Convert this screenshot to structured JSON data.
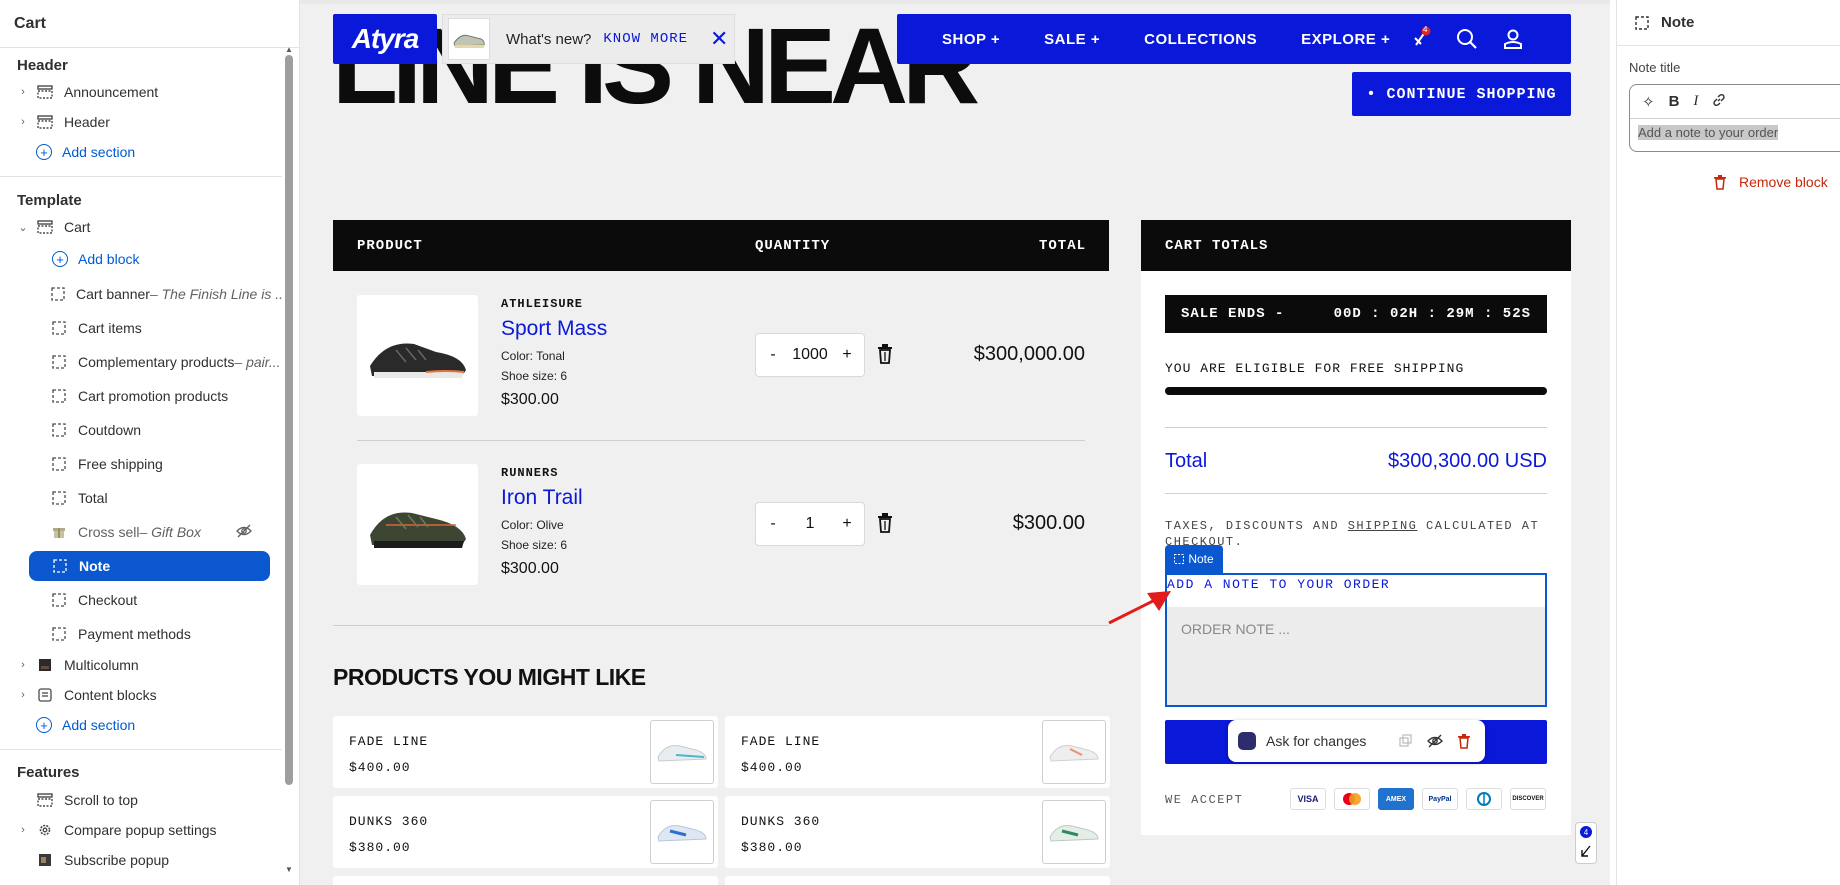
{
  "sidebar": {
    "title": "Cart",
    "header_section": "Header",
    "header_items": [
      {
        "label": "Announcement"
      },
      {
        "label": "Header"
      }
    ],
    "add_section": "Add section",
    "template_section": "Template",
    "cart_group": "Cart",
    "add_block": "Add block",
    "blocks": [
      {
        "label": "Cart banner",
        "sub": " – The Finish Line is ..."
      },
      {
        "label": "Cart items",
        "sub": ""
      },
      {
        "label": "Complementary products",
        "sub": " – pair..."
      },
      {
        "label": "Cart promotion products",
        "sub": ""
      },
      {
        "label": "Coutdown",
        "sub": ""
      },
      {
        "label": "Free shipping",
        "sub": ""
      },
      {
        "label": "Total",
        "sub": ""
      },
      {
        "label": "Cross sell",
        "sub": " – Gift Box"
      },
      {
        "label": "Note",
        "sub": ""
      },
      {
        "label": "Checkout",
        "sub": ""
      },
      {
        "label": "Payment methods",
        "sub": ""
      }
    ],
    "multicolumn": "Multicolumn",
    "content_blocks": "Content blocks",
    "add_section_2": "Add section",
    "features_section": "Features",
    "features": [
      {
        "label": "Scroll to top"
      },
      {
        "label": "Compare popup settings"
      },
      {
        "label": "Subscribe popup"
      }
    ]
  },
  "store": {
    "logo": "Atyra",
    "hero_text": "LINE IS NEAR",
    "whats_new": "What's new?",
    "know_more": "KNOW MORE",
    "nav": [
      "SHOP +",
      "SALE +",
      "COLLECTIONS",
      "EXPLORE +"
    ],
    "cart_count": "4",
    "continue_shopping": "• CONTINUE SHOPPING",
    "table_headers": {
      "product": "PRODUCT",
      "quantity": "QUANTITY",
      "total": "TOTAL"
    },
    "items": [
      {
        "category": "ATHLEISURE",
        "name": "Sport Mass",
        "color": "Color: Tonal",
        "size": "Shoe size: 6",
        "price": "$300.00",
        "qty": "1000",
        "total": "$300,000.00"
      },
      {
        "category": "RUNNERS",
        "name": "Iron Trail",
        "color": "Color: Olive",
        "size": "Shoe size: 6",
        "price": "$300.00",
        "qty": "1",
        "total": "$300.00"
      }
    ],
    "qty_minus": "-",
    "qty_plus": "+",
    "recommend_title": "PRODUCTS YOU MIGHT LIKE",
    "recommendations": [
      {
        "name": "FADE LINE",
        "price": "$400.00"
      },
      {
        "name": "FADE LINE",
        "price": "$400.00"
      },
      {
        "name": "DUNKS 360",
        "price": "$380.00"
      },
      {
        "name": "DUNKS 360",
        "price": "$380.00"
      }
    ],
    "cart_totals": {
      "title": "CART TOTALS",
      "sale_ends": "SALE ENDS -",
      "countdown": "00D : 02H : 29M : 52S",
      "free_shipping": "YOU ARE ELIGIBLE FOR FREE SHIPPING",
      "free_shipping_progress": 1.0,
      "total_label": "Total",
      "total_value": "$300,300.00 USD",
      "taxes_before": "TAXES, DISCOUNTS AND ",
      "taxes_link": "SHIPPING",
      "taxes_after": " CALCULATED AT CHECKOUT.",
      "note_tag": "Note",
      "note_label": "ADD A NOTE TO YOUR ORDER",
      "note_placeholder": "ORDER NOTE ...",
      "we_accept": "WE ACCEPT",
      "payments": [
        "VISA",
        "MC",
        "AMEX",
        "PayPal",
        "Diners",
        "DISCOVER"
      ]
    },
    "ask_for_changes": "Ask for changes",
    "mini_badge_count": "4"
  },
  "right_panel": {
    "title": "Note",
    "field_label": "Note title",
    "field_value": "Add a note to your order",
    "remove_block": "Remove block"
  },
  "colors": {
    "brand_blue": "#0a18d9",
    "editor_blue": "#0b57d0",
    "danger": "#c5280c"
  }
}
